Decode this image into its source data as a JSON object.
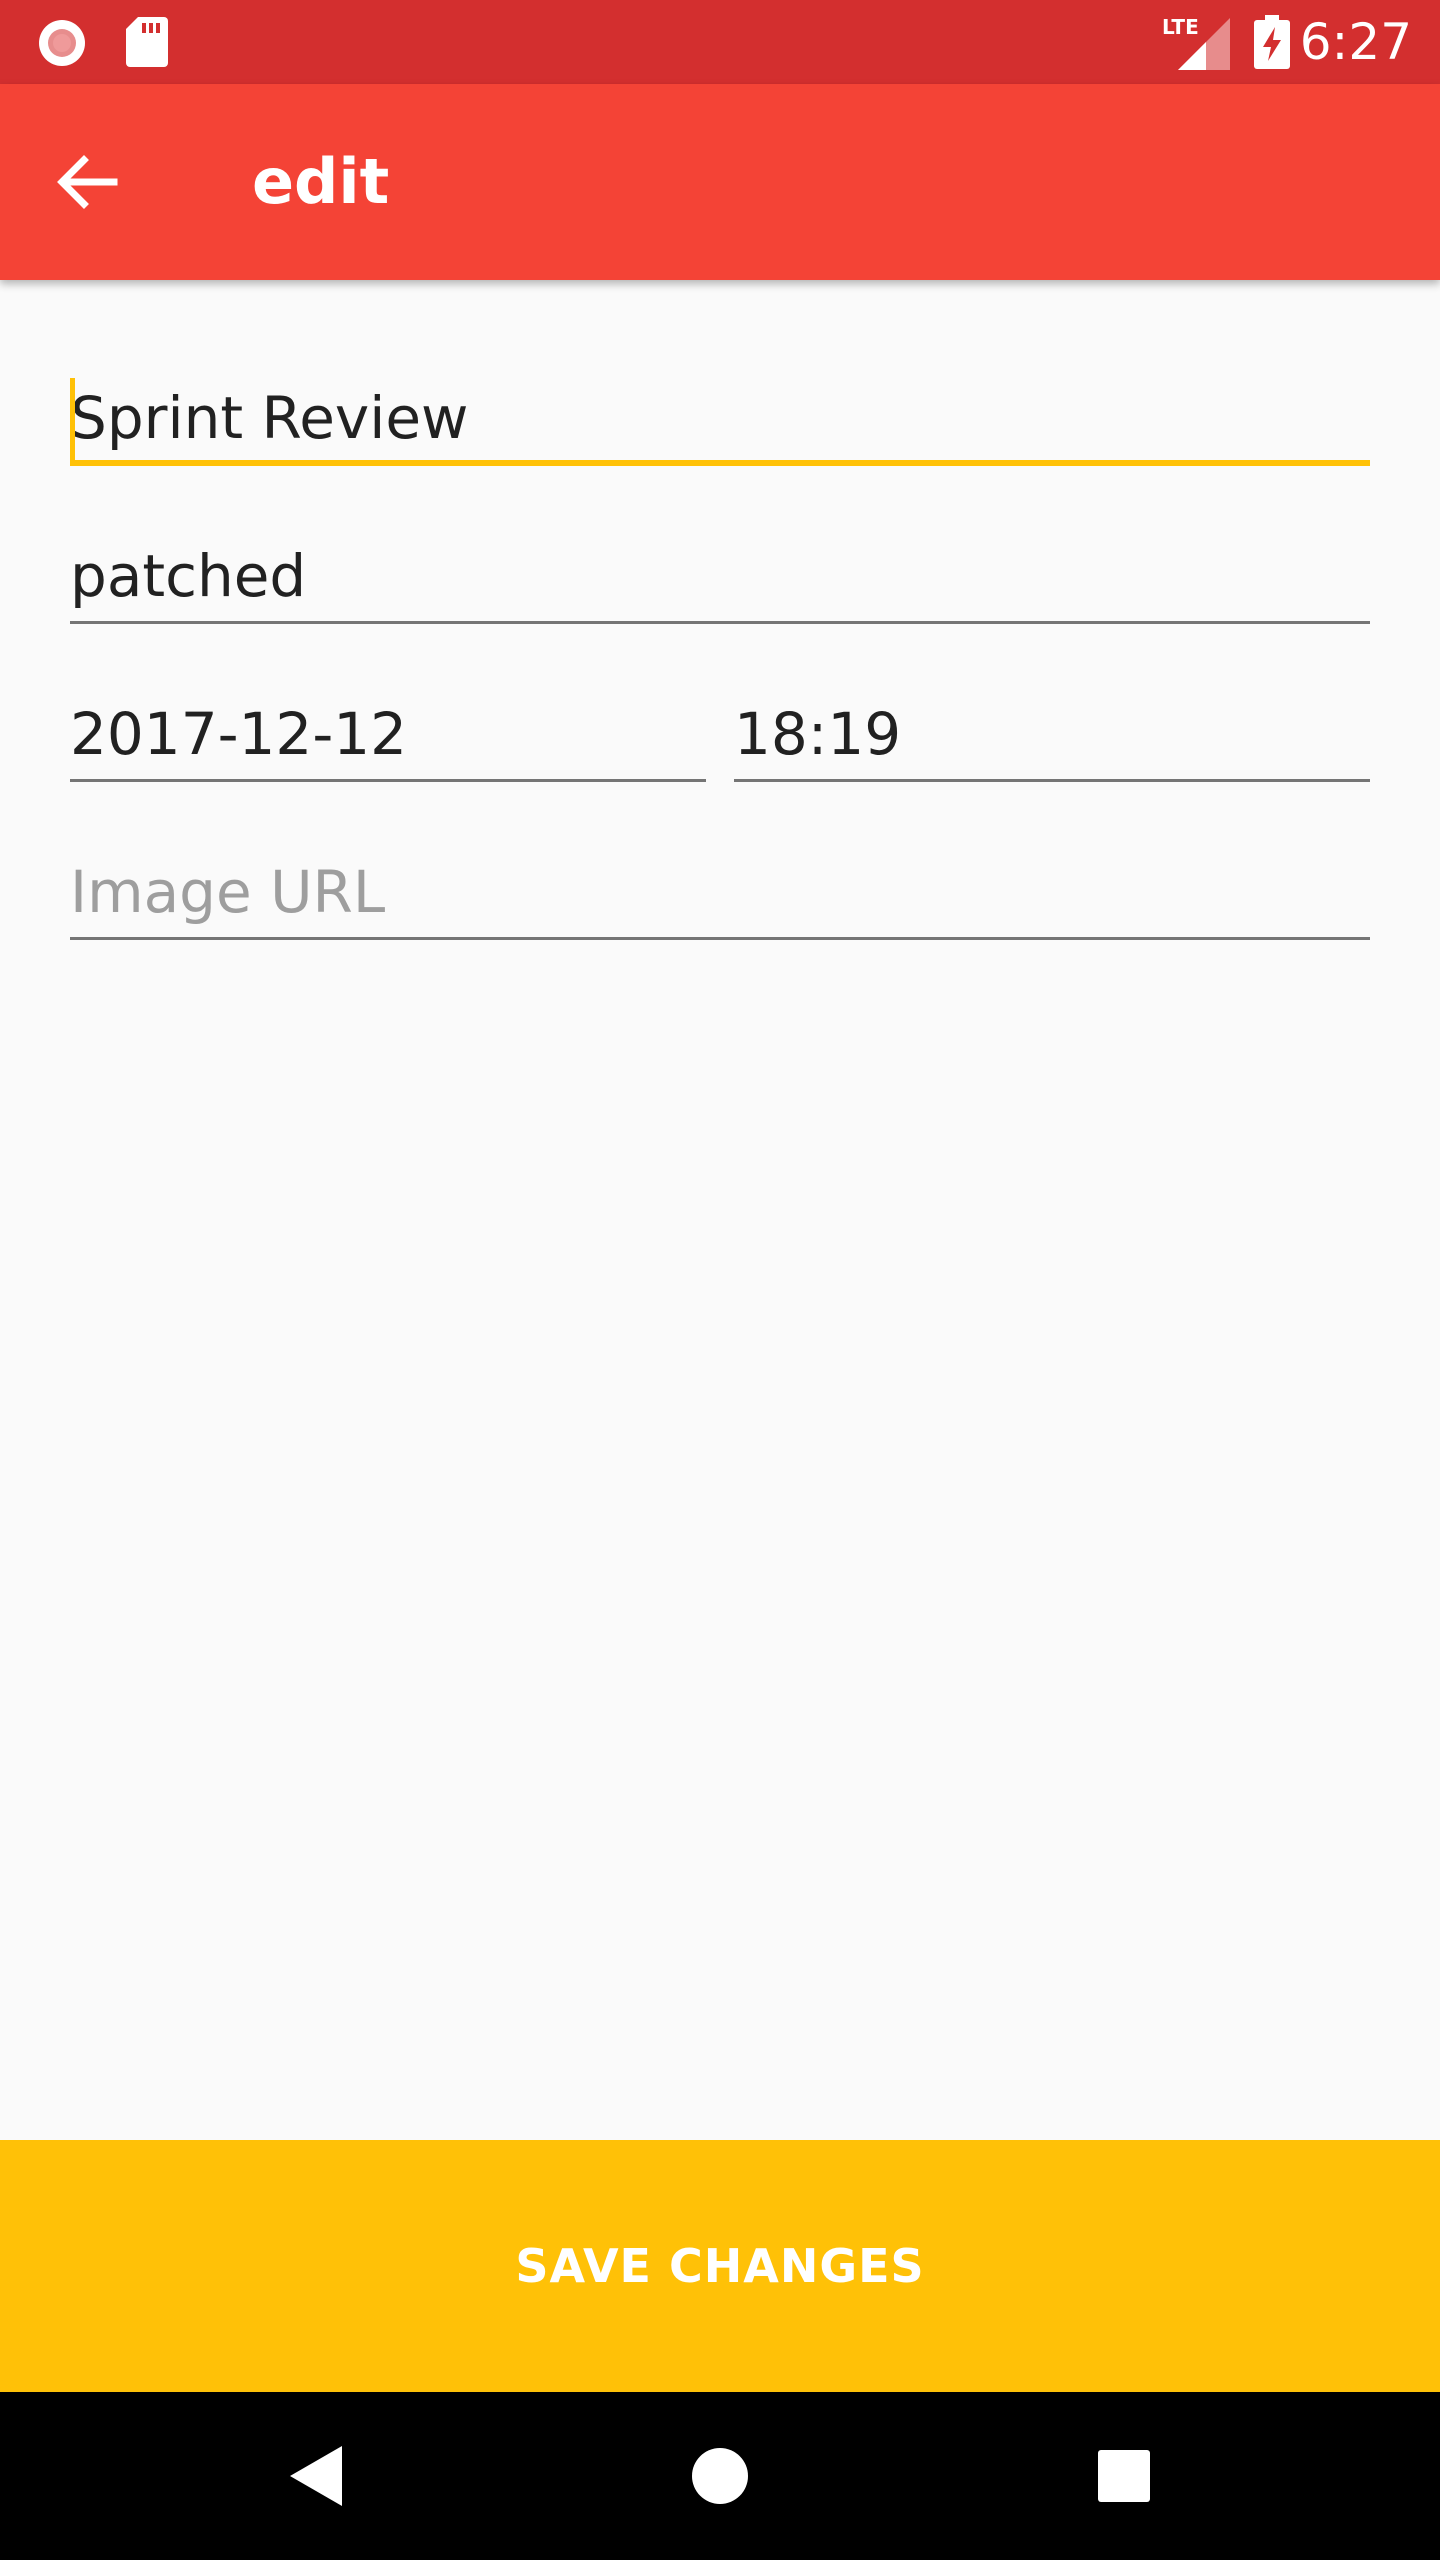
{
  "status_bar": {
    "time": "6:27",
    "network_label": "LTE",
    "icons": [
      "record-icon",
      "sd-card-icon",
      "lte-signal-icon",
      "battery-charging-icon"
    ]
  },
  "app_bar": {
    "title": "edit",
    "back_icon": "arrow-back-icon",
    "color": "#F44336"
  },
  "form": {
    "title_value": "Sprint Review",
    "description_value": "patched",
    "date_value": "2017-12-12",
    "time_value": "18:19",
    "image_url_value": "",
    "image_url_placeholder": "Image URL",
    "focused_field": "title",
    "accent_color": "#FFC107"
  },
  "save_button": {
    "label": "SAVE CHANGES",
    "color": "#FFC107"
  },
  "nav_bar": {
    "buttons": [
      "back-triangle-icon",
      "home-circle-icon",
      "recents-square-icon"
    ]
  }
}
